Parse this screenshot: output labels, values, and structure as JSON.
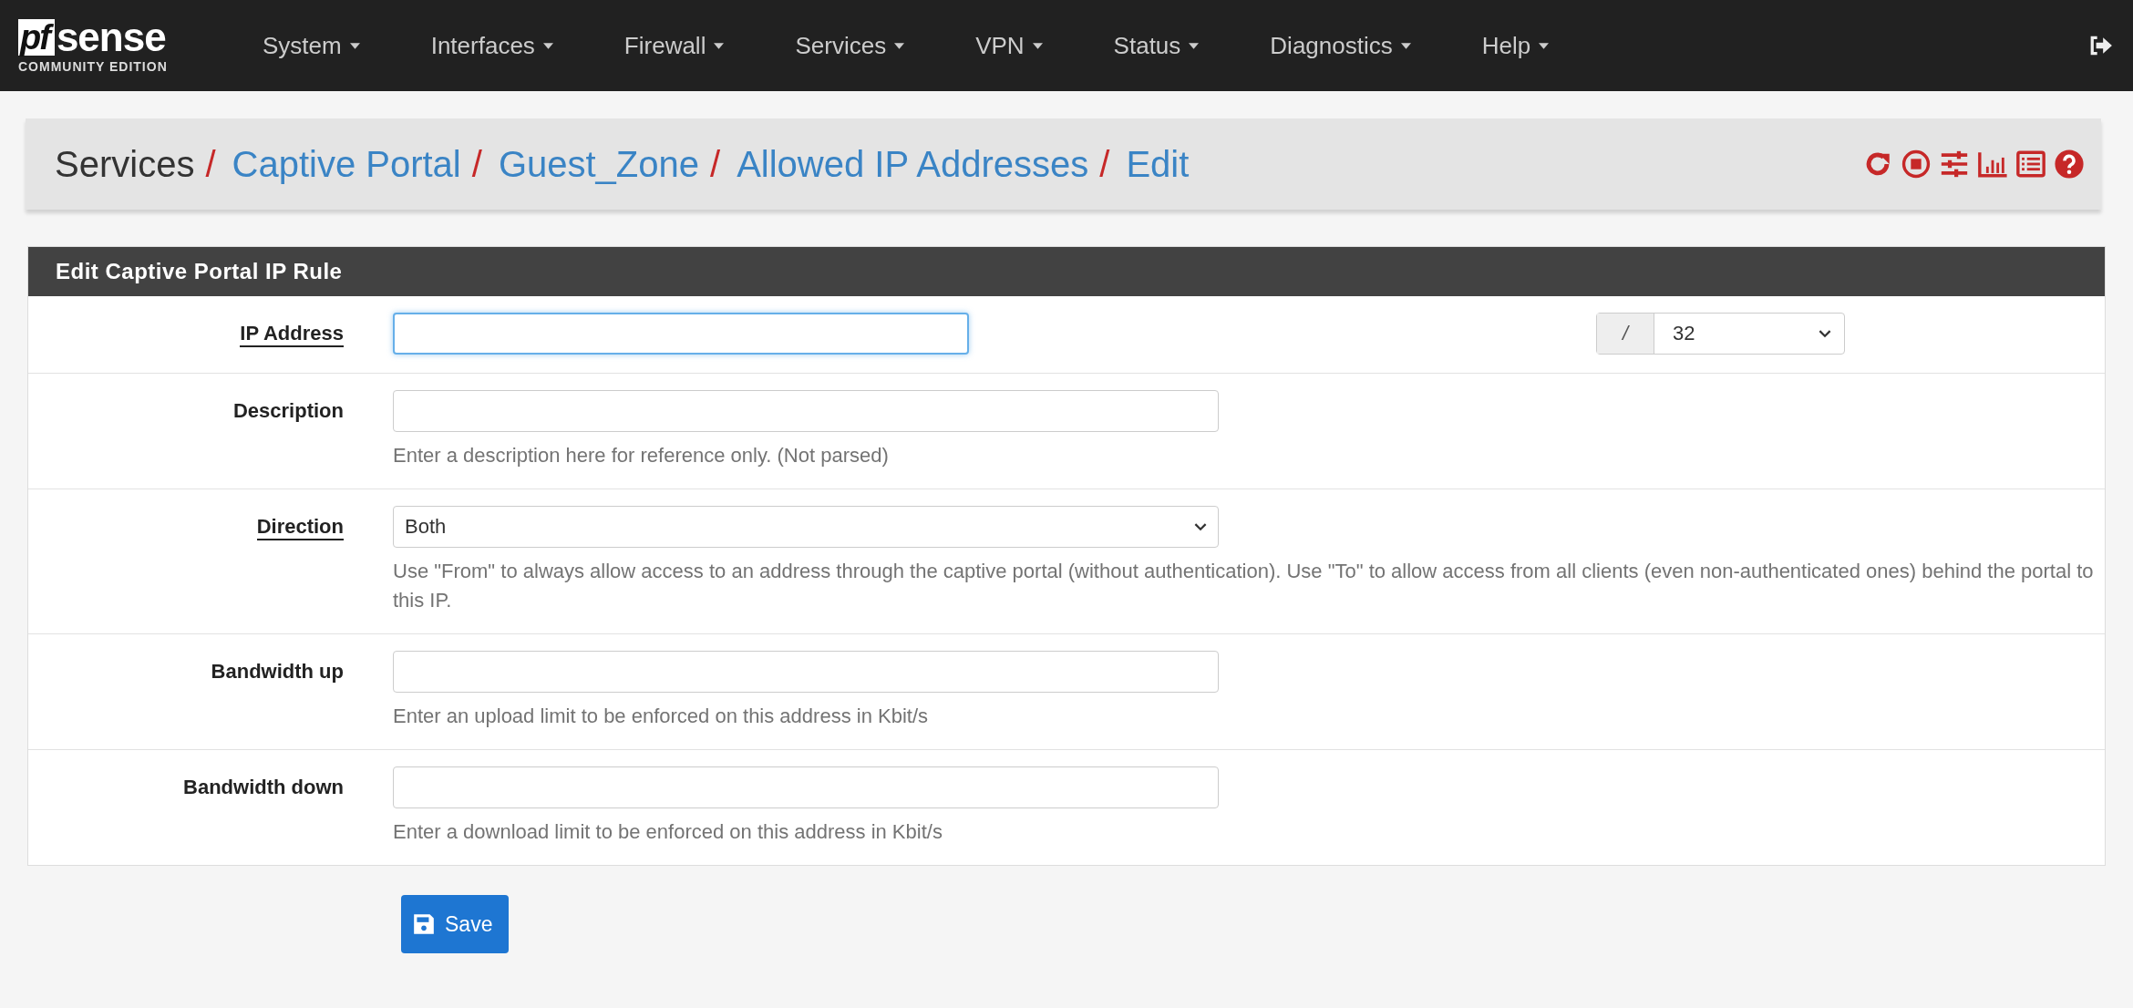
{
  "navbar": {
    "logo": {
      "mark": "pf",
      "word": "sense",
      "edition": "COMMUNITY EDITION"
    },
    "menu": [
      {
        "label": "System"
      },
      {
        "label": "Interfaces"
      },
      {
        "label": "Firewall"
      },
      {
        "label": "Services"
      },
      {
        "label": "VPN"
      },
      {
        "label": "Status"
      },
      {
        "label": "Diagnostics"
      },
      {
        "label": "Help"
      }
    ]
  },
  "breadcrumb": [
    {
      "label": "Services",
      "link": false
    },
    {
      "label": "Captive Portal",
      "link": true
    },
    {
      "label": "Guest_Zone",
      "link": true
    },
    {
      "label": "Allowed IP Addresses",
      "link": true
    },
    {
      "label": "Edit",
      "link": true
    }
  ],
  "breadcrumb_separator": "/",
  "panel": {
    "title": "Edit Captive Portal IP Rule",
    "fields": [
      {
        "kind": "ip",
        "label": "IP Address",
        "has_help": true,
        "focused": true,
        "separator": "/",
        "subnet": "32"
      },
      {
        "kind": "text",
        "label": "Description",
        "has_help": false,
        "focused": false,
        "help": "Enter a description here for reference only. (Not parsed)"
      },
      {
        "kind": "select",
        "label": "Direction",
        "has_help": true,
        "value": "Both",
        "focused": false,
        "help": "Use \"From\" to always allow access to an address through the captive portal (without authentication). Use \"To\" to allow access from all clients (even non-authenticated ones) behind the portal to this IP."
      },
      {
        "kind": "text",
        "label": "Bandwidth up",
        "has_help": false,
        "focused": false,
        "help": "Enter an upload limit to be enforced on this address in Kbit/s"
      },
      {
        "kind": "text",
        "label": "Bandwidth down",
        "has_help": false,
        "focused": false,
        "help": "Enter a download limit to be enforced on this address in Kbit/s"
      }
    ]
  },
  "save_button": "Save"
}
